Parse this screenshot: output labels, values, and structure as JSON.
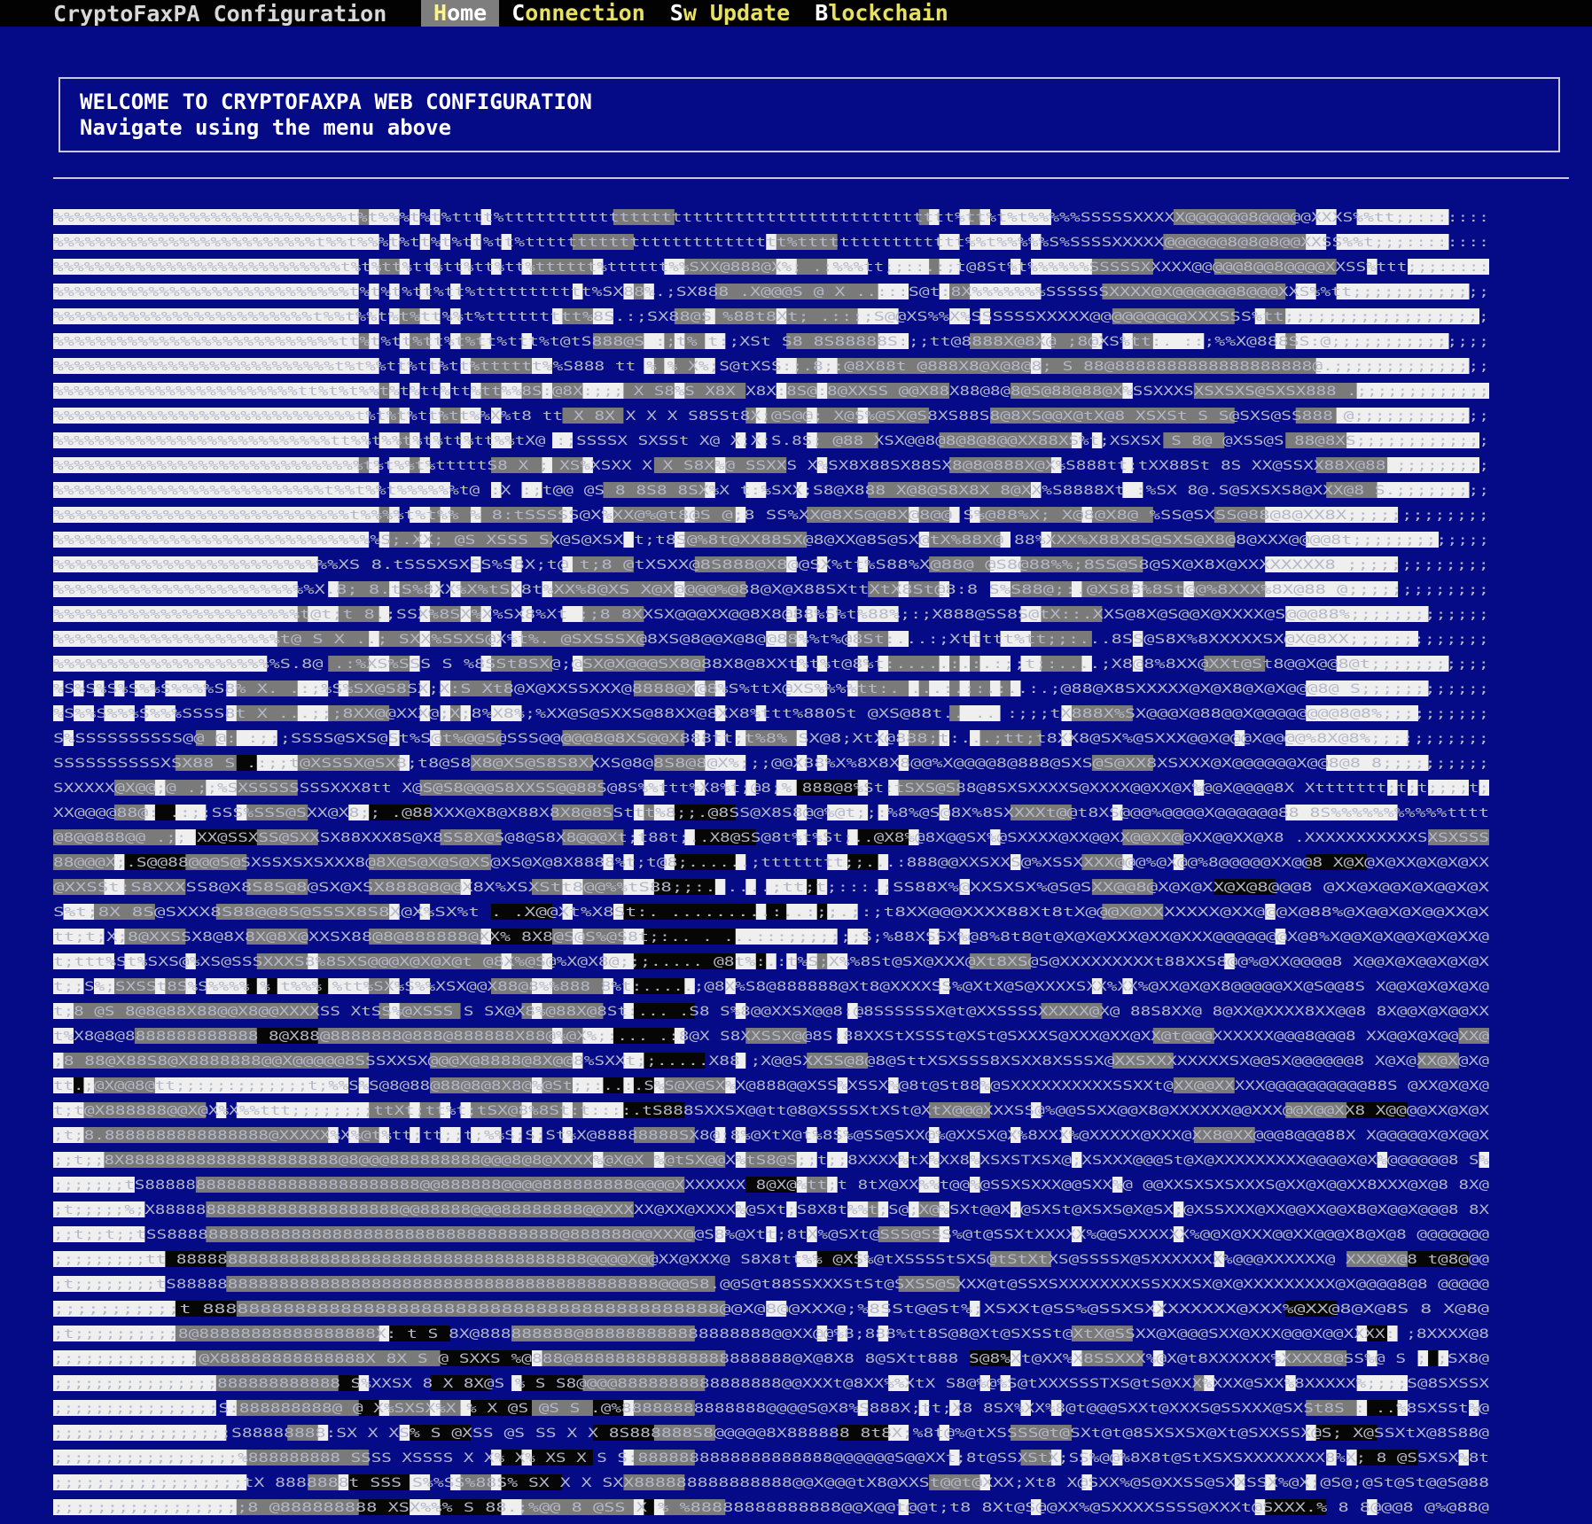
{
  "menubar": {
    "title": "CryptoFaxPA Configuration",
    "items": [
      {
        "key": "home",
        "hot": "H",
        "rest": "ome",
        "active": true
      },
      {
        "key": "connection",
        "hot": "C",
        "rest": "onnection",
        "active": false
      },
      {
        "key": "sw-update",
        "hot": "S",
        "rest": "w Update",
        "active": false
      },
      {
        "key": "blockchain",
        "hot": "B",
        "rest": "lockchain",
        "active": false
      }
    ]
  },
  "welcome": {
    "heading": "WELCOME TO CRYPTOFAXPA WEB CONFIGURATION",
    "subtext": "Navigate using the menu above"
  },
  "ascii_art": {
    "description_free_content": "ascii-portrait",
    "colors": {
      "light": "#efefef",
      "mid": "#7a7a7a",
      "dark": "#050a86",
      "black": "#060606",
      "accent_green": "#3aa858",
      "accent_blue": "#2832c8"
    },
    "rows": [
      "%%%%%%%%%%%%%%%%%%%%%%%%%%%%t%t%%%t%t%tttt%ttttttttttttttttttttttttttttttttttttttttttt%tt%t%t%%%%%SSSSSXXXXX@@@@@@8@@@@@XXXS%%tt;;:::::::",
      "%%%%%%%%%%%%%%%%%%%%%%%%%t%%t%%%t%tt%t%tt%tt%ttttttttttttttttttttttttt%tttttttttttttttt%%t%%%%%S%SSSSXXXXX@@@@@@8@8@8@@XXSS%%t;;;::::::::",
      "%%%%%%%%%%%%%%%%%%%%%%%%%%%%t%t%tt%tt%tt%tt%tt%tttttt%tttttt%%SXX@888@X%;  .:%%%tt;;::.:;t@8St%t%%%%%%SSSSSXXXXX@@@@@8@@8@@@@XXSS%ttt;;;:::::",
      "%%%%%%%%%%%%%%%%%%%%%%%%%%%%t%t%t%tt%tt%ttttttttttt%SX88%.;SX888 .X@@@S @ X    ..:::S@t:8X%%%%%%%SSSSSSXXXX@X@@@@@@8@@@XXS%%tt;;;;;;;;;;;;;",
      "%%%%%%%%%%%%%%%%%%%%%%%%t%%t%%t%t%tt%%t%ttttttttt%8S.:;SX88@S   %88t8Xt;      .:::;S@@XS%%X%SSSSSSXXXXX@@@@@@@@@XXXSSS%tt;;;;;;;;;;;;;;;;;;;",
      "%%%%%%%%%%%%%%%%%%%%%%%%%%%tt%t%tt%tt%t%tt%ttt%t@tS888@S  :;t% t:;XSt S8 8S88888S:;;tt@8888X@8X@ ;8@XS%tt:. ::;%%X@888SS:@;;;;;;;;;;;;;;;",
      "%%%%%%%%%%%%%%%%%%%%%%%%%%%t%t%%tt%tt%tt%tttttt%%S888  tt % % X%;S@tXSS:;.8;:@8X88t @888X8@X@8@8; S 88@8888888888888888888@.;;;;;;;;;;;;;;;",
      "%%%%%%%%%%%%%%%%%%%%%%%%tt%t%t%%t%t%tt%tt%tt%%8S:@8X:;;; X S8%S X8X X8X:8S@:8@XXSS @@X88X88@8@8@S@88@88@X%SSXXXSXSXSXS@SXSX888 .;;;;;;;;;;;;;",
      "%%%%%%%%%%%%%%%%%%%%%%%%%%%%%t%t%t%tt%tt%%X%t8  tt X 8X X X X S8SSt8X;@S@@; X@S%@SX@S8XS88S8@8XS@@X@tX@8 XSXSt S S@SXS@SS888 @;;;;;;;;;;;;;",
      "%%%%%%%%%%%%%%%%%%%%%%%%%%%tt%%t%%t%t%tt%tt%%tX@ :;SSSSX SXSSt X@ X;X:S.8S; @88 XSX@@8@8@8@8@@XX88XS%t;XSXSX S 8@ @XSS@S 88@8XS;;;;;;;;;;;;;",
      "%%%%%%%%%%%%%%%%%%%%%%%%%%%%%%t%t%%t%tttttS8 X  ; XS%XSXX X X S8X%@ SSXXS X%SX8X88SX88SX8@8@888X@X%S888tt;tXX88St 8S XX@SSXX88X@88 ;;;;;;;;;",
      "%%%%%%%%%%%%%%%%%%%%%%%%%%t%%t%%t%%%%%%t@  :X :;t@@ @S 8 8S8 8SX%X t:%SXX;S8@X888 X@8@S8X8X 8@XX%S8888Xt :%SX 8@.S@SXSXS8@XXX@8 S.;;;;;;;;;",
      "%%%%%%%%%%%%%%%%%%%%%%%%%%%t%%%%t%t%% % 8:tSSSSS@X%XX@%@t8@S @;8 SS%XX@8XS@@8X@8@@ S%@88%X; X@8@X8@  %SS@SXSS@88@8@XX8X;;;;;;;;;;;;;",
      "%%%%%%%%%%%%%%%%%%%%%%%%%%%%%%%S;.XX; @S XSSS SX@S@XSX t;t8S@%8t@XX88SX@8@XX@8S@SX@tX%88X@ 88%XXX%X88X8S@SXS@X8@8@XXX@@@@8t;;;;;;;;;;;;;",
      "%%%%%%%%%%%%%%%%%%%%%%%%%%XS  8.tSSSXSXSS%S8X;t@ t;8 @tXSXX@8S888@X8@@SX%tt%S88%X@88@ @S8@88%%;8SS@S8@SX@X8X@XXXXXXXX8 ;;;;;;;;;;;;;",
      "%%%%%%%%%%%%%%%%%%%%%%%%X.8; 8.tS%8XX%X%tSX8t%XX%8@XS X@X@@@@%@88@X@X88SXttXtX8St@8:8 S%S88@;:.@XS88%8St@@%8XXX%8X@88 @;;;;;;;;;;;;;",
      "%%%%%%%%%%%%%%%%%%%%%%%t@t;t  8.;SSX%8SX%X%SX8%Xt ;;8 8XXSX@@@XX@@8X8@88%S%t%88%;:;X888@SS8S@tX::.XXS@8X@S@@X@XXXX@S@@@88%;;;;;;;;;;;;;",
      "%%%%%%%%%%%%%%%%%%%%%t@  S X ..; SXX%SSXS@X%t%. @SXSSSX@8XS@8@@X@8@@88%%t%@8St:...:;Xttttt%tt;;:...8SS@S8X%8XXXXXSX@X@8XX;;;;;;;;;;;;;",
      "%%%%%%%%%%%%%%%%%%%%%S.8@     .:%XS%SSS S %8SSt8SX@;@SX@X@@@SX8@88X8@8XXt%t%t@8%t:.....:.:.:;;t;:....;X8@8%8XX@XXt@St8@@X@@8@t;;;;;;;;;;;",
      "%S%S%S%S%%S%%%%S8% X.  .:;%S%SX@S8SX;X:S Xt8@X@XXSSXXX@8888@X@8%S%ttX@XS%%%%tt:. ...:.::.:..:.;@88@X8SXXXXX@X@X8@X@X@@@8@ S;;;;;;;;;;;;",
      "%S%%S%%%S%%%SSSS8t X ...;;;8XX@@XXX@;X;8%X8%;%XX@S@SXXS@88XX@8XX8%ttt%880St @XS@88t.. .. :;;;tX888X%SX@@@X@88@@X@@@@@@@@8@8%;;;;;;;;;;",
      "S%SSSSSSSSSS@@ @: :;;;SSSS@SXS@St%S@t%@@S@SSS@@@@@8@8XS@@X888tt;t%8% SX@8;XtX@888;t:...;tt;t8XX8@SX%@SXXX@@X@@@X@@@@%8X@8%;;;;;;;;;;;",
      "SSSSSSSSSSXSX88 S  .:;;t@XSSSX@SX8;t8@S8X8@XS@S8S8XXXS@8@8S8@8@X%;;;@@X88%X%8X8X8@@%X@@@@8@888@SXS@S@XX8XSXXX@X@@@@@@X@@8@8 8;;;;;;;;;;",
      "SXXXXX@X@@;@  .;;%SXSSSSSSSSXXX8tt X@S@S8@@@S8XXSS@@88S@8S%%ttt%X8%t;@8;% 888@8%St:tSXS@S88@8SXSXXXXS@XXXX@@XX@X%@@X@@@@8X Xttttttt;t;t;;;;t;;;",
      "XX@@@@88@: .:;;SSS%SSS@SXX@X8;; .@88XXX@X8@X88X8X8@8SSttt%8;;.@8SS@X8S8@@%@t;;:%8%@S@8X%8SXXXXt@@t8XS@@@%@@@@X@@@@@@88 8S%%%%%%%%%%%tttt",
      "@8@@888@@  .;; XX@SSXSS@SXXSX88XXX8S@X8SS8X@S@8@S8X8@@@Xt;t88t;..X8@SS@8t%t%St;..@X8%@8X@@SX%@SXXXX@XX@@XX@@XX@@XX@@XX@X8 .XXXXXXXXXXXSXSXSSSS",
      "88@@@X;.S@@88@@@S@SXSSXSXSXXX8@8X@S@X@S@XS@XS@X@8X8888%t;t@8;......;tttttttt;;...:888@@XXSXXS@%XSSXXXX@@@%@X@@%8@@@@@XX@@8  X@X@X@XX@X@X@XX",
      "@XXSSt:S8XXXSS8@X8S8S@8@SX@XSX888@8@@X8X%XSXStt8@@%%tS88;;:. ....;tt;t;:::.;SS88X%@XXSXSX%@S@SXX@@8@X@X@XX@X@8@@@8 @XX@X@@X@X@@X@X",
      "S%t;8X 8S@SXXX8S88@@8S@SSSX8S8X@X%SX%t   .  .X@@Xt%X8St:.   .........:..:;;.;:;t8XX@@@XXXX88Xt8tX@@@X@XXXXXXX@XX@@@X@88%@X@@X@X@@XX@X",
      "tt;t;X;8@XXSSX8@8X8X@8X@XXSX88@8@888888@XX% 8X8@S@S%@S8t;:.. .  ...:::;;;;;;;S;%88XSSX%@8%8t8@t@X@X@XXX@XX@XXX@@@@@@@X@8%X@@X@X@@X@X@XX@",
      "t;ttt%St%SXS@%XS@SSSXXXS8%8SXS@@@X@X@X@t @8X%@S@%X@X8@;;;.....  @8t%:.:t%S;X%%8St@SX@XXX@Xt8XS@S@XXXXXXXXXt88XXS8@@%@XX@@@@8 X@@X@X@@X@X@X",
      "t;;S%;SXSSt8S%S%%%% % t%%% %tt%SX%S%%XSX@@X88@8%%888 8%t:.....;@8X%S8@888888@Xt8@XXXXSS%@XtX@S@XXXXSXX%XX%@XX@X@X8@@@@@XX@S@@8S X@@X@X@X@X@",
      "t;8 @S 8@8@88X88@@X8@@XXXXSS XtSS%@XSSS S SX@X8%@88X@8St:...  .S8 S%8@@XXSX@@8:@8SSSSSSX@t@XXSSSSXXXXX@X@ 88S8XX@ 8@XX@XXXX8XX@@8 8X@@X@X@@XX@",
      "t%X8@8@8888888888888 8@X88@8888888@888@888888X88@%@X%;:...  .:8@X S8XXSSX@@8S:88XXStXSSSt@XSt@SXXXS@XXX@XX@XX@t@@@XXXXXX@@@8@@@8 XX@@X@X@@XX@",
      ";8 88@X88S8@X8888888@@X@@@@@8SSSXXSX@@@X@8888@8X@@8%SXXt;;.....X88 ;X@@SXXSS@8@8@SttXSXSSS8XSXX8XSSSX@XXSXXXXXXXXSX@@SX@@@@@@8 X@X@XX@X@X@",
      "tt.;@X@@8@tt;;:;;:;;;;;;;t;%%S%S@8@88@88@8@8X8@%@St;;:..:.S%S@X@SX%X@888@@XSS%XSSX%@8t@St88%@SXXXXXXXXXXSSXXt@XX@@XXXXX@@@@@@@@@@88S @XX@X@X@XX",
      "t;t@X888888@@X@X%X%%ttt;;;;;;;;ttXt;tt%t;tSX@8%8St:t::::.tS888SXXSX@@tt@8@XSSSXtXSt@XtX@@@XXXSS@%@@SSXX@@X8@XXXXXX@@XXX@@X@@XX8 X@@@@XX@X@X",
      ";t;8.8888888888888888@XXXXX%X%@t%tt;tt;;t;%%S;S;St%X@88888888SX8@;8%@XtX@t%8S%@SS@SXX@%@XXSX@X%8XXX%@XXXXX@XXX@XX8@XX@@@8@@@88X X@@@@@X@X@@X",
      ";;t;;8X888888888888888888888@8@@@888888888@@@8@8@XXXX%@X@X %@tSX@@X%tS8@S;;t;;8XXXX%tX%XX8%XSXSTXSX@;XSXXX@@@St@X@XXXXXXXXX@@@@X@X%@@@@@@8 S%@X@@@@@@X",
      ";;;;;;;tS888888888888888888888888888@@888888@@@@888888888@@@@XXXXXXX 8@X@%tt;t 8tX@XX%%t@@%@SSXSXXX@@SXX%@ @@XXSXSXSXXXS@XX@X@@XX8XXX@X@8 8X@@@@@@",
      ";t;;;;;%;X888888888888888888888888@@88888@@@88888888@@XXXXX@XX@XXXX%@SXt;S8X8t%%t;S@;X@%SXt@@X;@SXSt@XSXS@X@SX;@XSSXXX@XX@@XX@@X8@X@@X@@@8 8X@@@@@@",
      ";;t;;t;;tSS88888888888888888888888888888888888888@888888@@XXX@@S8%@Xtt;8tX%@SXt@SSS@SSS%@t@SSXtXXXXX%@@SXXXXXX%@@X@XXX@@XX@@@X8@X@8 @@@@@@@",
      ";;;;;;;;;tt 8888888888888888888888888888888888888888@@@@X@@XX@XXX@ S8X8tt%% @XS%@tXSSSStSXS@tStXtXS@SSSSX@SXXXXXXX%@@@XXXXXX@ XXX@X@8 t@8@@@",
      ";t;;;;;;;;tS88888888888888888888888888888888888888888888888@@@S8.@@S@t88SSXXXStSt@SXSS@SXXX@t@SSXSXXXXXXXXSSXXXSX@X@XXXXXXXXX@X@@@@8@8 @@@@@",
      ";;;;;;;;;;;t  888888888888888888888888888888888888888888888@@X@8@@XXX@;%8SSt@@St%;XSXXt@SS%@SSXSXXXXXXXX@XXX%@XX@8@X@8S 8 X@8@",
      ";t;;;;;;;;;;8@88888888888888888X: t S 8X@888888888@888888888888888888@@XX@@%8;888%tt8S@8@Xt@SXSSt@XtX@SSXX@X@@@SXX@XXX@@@X@@XXXX:  ;8XXXX@8  X@8",
      ";;;;;;;;;;;;;;@X88888888888888X 8X S @ SXXS    %@888@888888888888888888888@X@8X8 8@SXtt888 S@8%Xt@XX%X8SSXXX%@X@t8XXXXXX%XXXX8@SS%@ S ; ;SX8@X@X @@",
      ";;;;;;;;;;;;;;;;888888888888 S%XXSX 8 X 8X@S % S  S8@@@@8888888888888888@@XXXt@8XX%%XtX S8@%@%S@tXXXSSSTXS@tS@XXX%XXX@SXX%8XXXXX%;;;;S@8SXSSX  8@",
      ";;;;;;;;;;;;;;;;S:888888888@ @ X%SXSX%X % X @S @S  S  .@%88888888888888@@@@S@X8%S888X;tt;X8 8SX%XX%8@t@@@SXXt@XXXS@SSXXX@SXSt8S : ..%8SXSSt%@.88@",
      ";;;;;;;;;;;;;;;;;S88888888:SX X XS% S @XSS @S SS X  X 8S888888S8@@@@@8X888888 8t8X;%8t@%@tXSSSS@t@SXt@t@8SXSXSX@Xt@SXXSSX@S;  X@SSXtX@8S88@",
      ";;;;;;;;;;;;;;;;;;%888888888 SSSS XSSSS X X% X% XS X S S:8888888888888888888@@@@@@S@@XXt;8t@SSXStX;SS%@@%8X8t@StXSXSXXXXXXXX8%X; 8  @SSXSX%8t@88",
      ";;;;;;;;;;;;;;;;;;tX 8888888t SSS S%%SS%88S% SX X X SXX888888888888888@@X@@@tX8@XXSt@@t@XXX;Xt8 X@SXX%@S@XXSS@SXXSSX%@X;@S@;@St@St@@S@88",
      ";;;;;;;;;;;;;;;;;;8 @888888888  XSX%%% S 88.;%@@ 8 @SS X % %88888888888888@@X@@t@@t;t8 8Xt@S@@XX%@SXXXXSSSS@XXXt@SXXX.% 8 8@@@8 @%@88@"
    ]
  }
}
